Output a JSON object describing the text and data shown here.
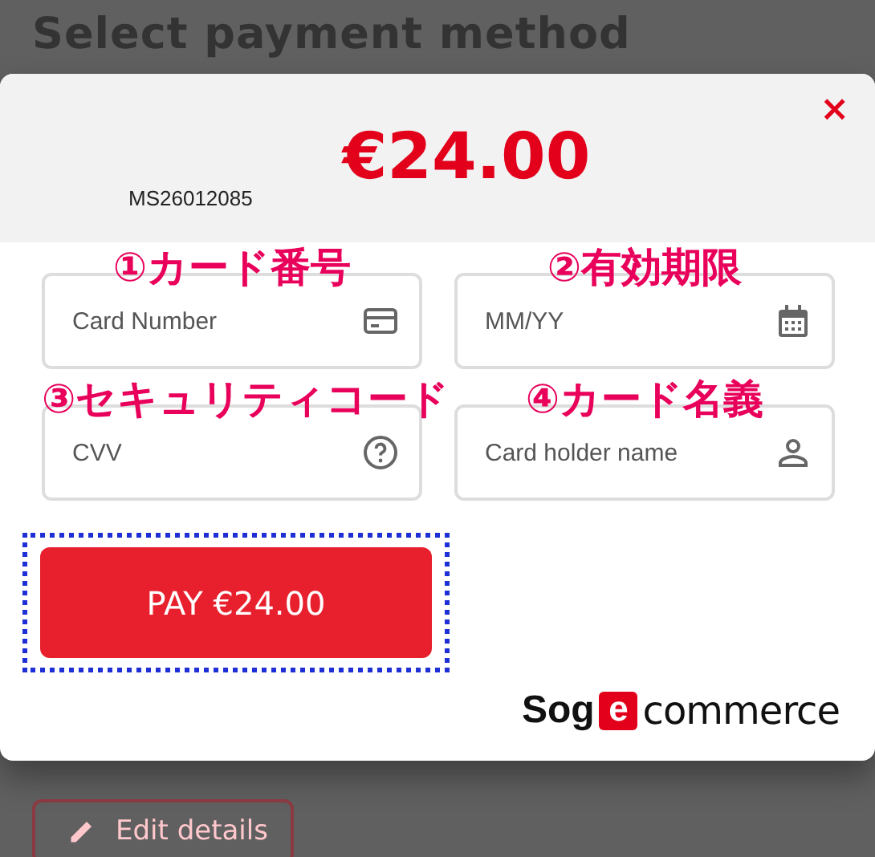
{
  "page": {
    "title": "Select payment method",
    "edit_button": "Edit details"
  },
  "dialog": {
    "close": "×",
    "amount": "€24.00",
    "order_number": "MS26012085",
    "fields": [
      {
        "annotation": "①カード番号",
        "placeholder": "Card Number",
        "kind": "card"
      },
      {
        "annotation": "②有効期限",
        "placeholder": "MM/YY",
        "kind": "calendar"
      },
      {
        "annotation": "③セキュリティコード",
        "placeholder": "CVV",
        "kind": "help"
      },
      {
        "annotation": "④カード名義",
        "placeholder": "Card holder name",
        "kind": "person"
      }
    ],
    "pay_button": "PAY €24.00",
    "logo": {
      "prefix": "Sog",
      "mark": "e",
      "suffix": "commerce"
    }
  }
}
